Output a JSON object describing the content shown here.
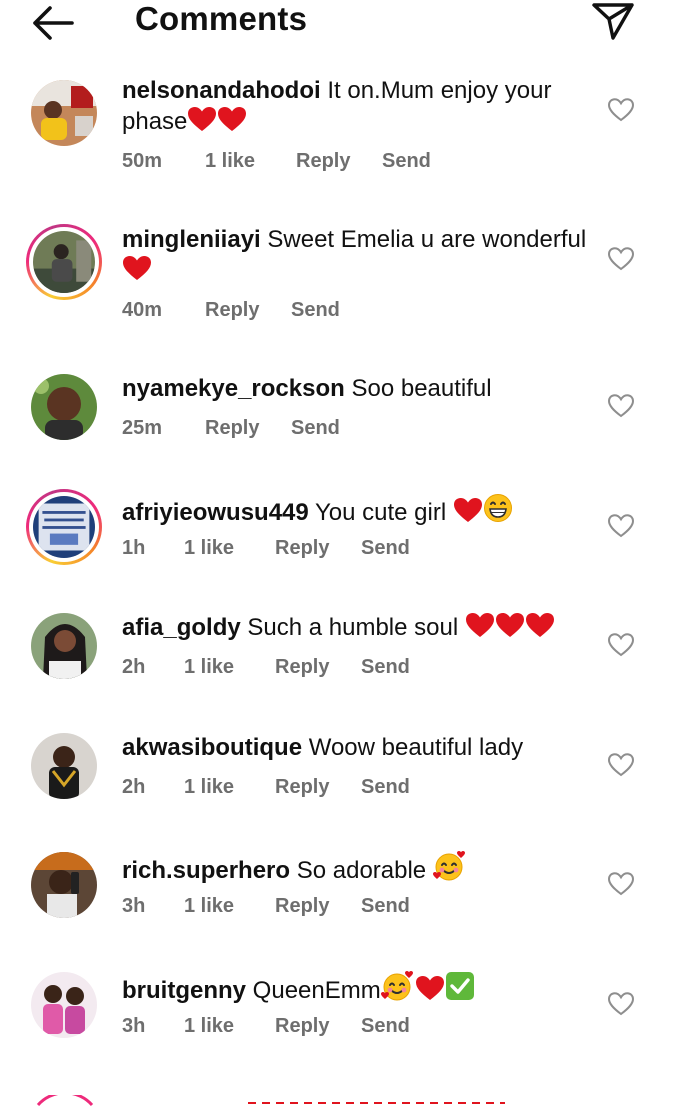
{
  "header": {
    "title": "Comments",
    "back_icon": "arrow-left-icon",
    "share_icon": "paper-plane-icon"
  },
  "comments": [
    {
      "username": "nelsonandahodoi",
      "text": "It on.Mum enjoy your phase",
      "emoji": [
        "heart",
        "heart"
      ],
      "time": "50m",
      "likes": "1 like",
      "reply": "Reply",
      "send": "Send",
      "story_ring": false
    },
    {
      "username": "mingleniiayi",
      "text": "Sweet Emelia u are wonderful",
      "emoji": [
        "heart"
      ],
      "time": "40m",
      "likes": "",
      "reply": "Reply",
      "send": "Send",
      "story_ring": true
    },
    {
      "username": "nyamekye_rockson",
      "text": "Soo beautiful",
      "emoji": [],
      "time": "25m",
      "likes": "",
      "reply": "Reply",
      "send": "Send",
      "story_ring": false
    },
    {
      "username": "afriyieowusu449",
      "text": "You cute girl",
      "emoji": [
        "heart",
        "grin"
      ],
      "time": "1h",
      "likes": "1 like",
      "reply": "Reply",
      "send": "Send",
      "story_ring": true
    },
    {
      "username": "afia_goldy",
      "text": "Such a humble soul",
      "emoji": [
        "heart",
        "heart",
        "heart"
      ],
      "time": "2h",
      "likes": "1 like",
      "reply": "Reply",
      "send": "Send",
      "story_ring": false
    },
    {
      "username": "akwasiboutique",
      "text": "Woow beautiful lady",
      "emoji": [],
      "time": "2h",
      "likes": "1 like",
      "reply": "Reply",
      "send": "Send",
      "story_ring": false
    },
    {
      "username": "rich.superhero",
      "text": "So adorable",
      "emoji": [
        "smiling-hearts"
      ],
      "time": "3h",
      "likes": "1 like",
      "reply": "Reply",
      "send": "Send",
      "story_ring": false
    },
    {
      "username": "bruitgenny",
      "text": "QueenEmm",
      "emoji": [
        "smiling-hearts",
        "heart",
        "check"
      ],
      "time": "3h",
      "likes": "1 like",
      "reply": "Reply",
      "send": "Send",
      "story_ring": false
    }
  ],
  "colors": {
    "heart": "#e0141e",
    "meta": "#6e6e6e",
    "ring_start": "#f9ce34",
    "ring_mid": "#ee2a7b",
    "ring_end": "#c13584"
  }
}
